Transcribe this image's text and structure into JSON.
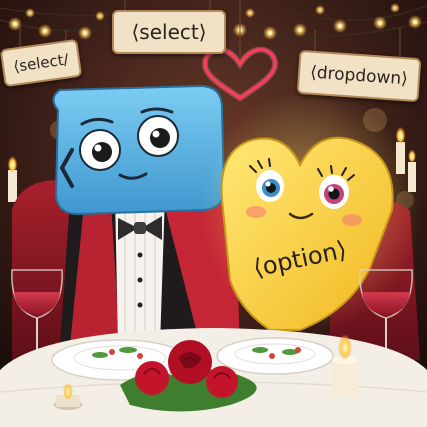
{
  "signs": {
    "left": "⟨select/",
    "top": "⟨select⟩",
    "right": "⟨dropdown⟩"
  },
  "characters": {
    "yellow_heart_label": "⟨option⟩"
  },
  "colors": {
    "background": "#3a1e17",
    "blue_character": "#5bb7e8",
    "yellow_character": "#f7d43b",
    "neon_heart": "#ff3b5c",
    "roses": "#c4102a"
  },
  "icons": {
    "heart": "neon-heart-icon",
    "rose": "rose-icon",
    "candle": "candle-icon",
    "wine_glass": "wine-glass-icon",
    "bow_tie": "bow-tie-icon"
  }
}
